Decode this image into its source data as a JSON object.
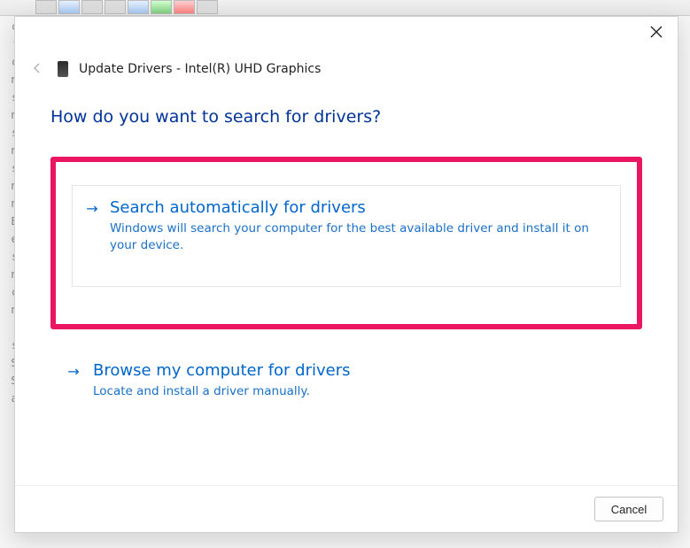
{
  "header": {
    "title": "Update Drivers - Intel(R) UHD Graphics"
  },
  "question": "How do you want to search for drivers?",
  "options": [
    {
      "title": "Search automatically for drivers",
      "desc": "Windows will search your computer for the best available driver and install it on your device."
    },
    {
      "title": "Browse my computer for drivers",
      "desc": "Locate and install a driver manually."
    }
  ],
  "footer": {
    "cancel": "Cancel"
  },
  "highlight": {
    "color": "#ea1662"
  }
}
